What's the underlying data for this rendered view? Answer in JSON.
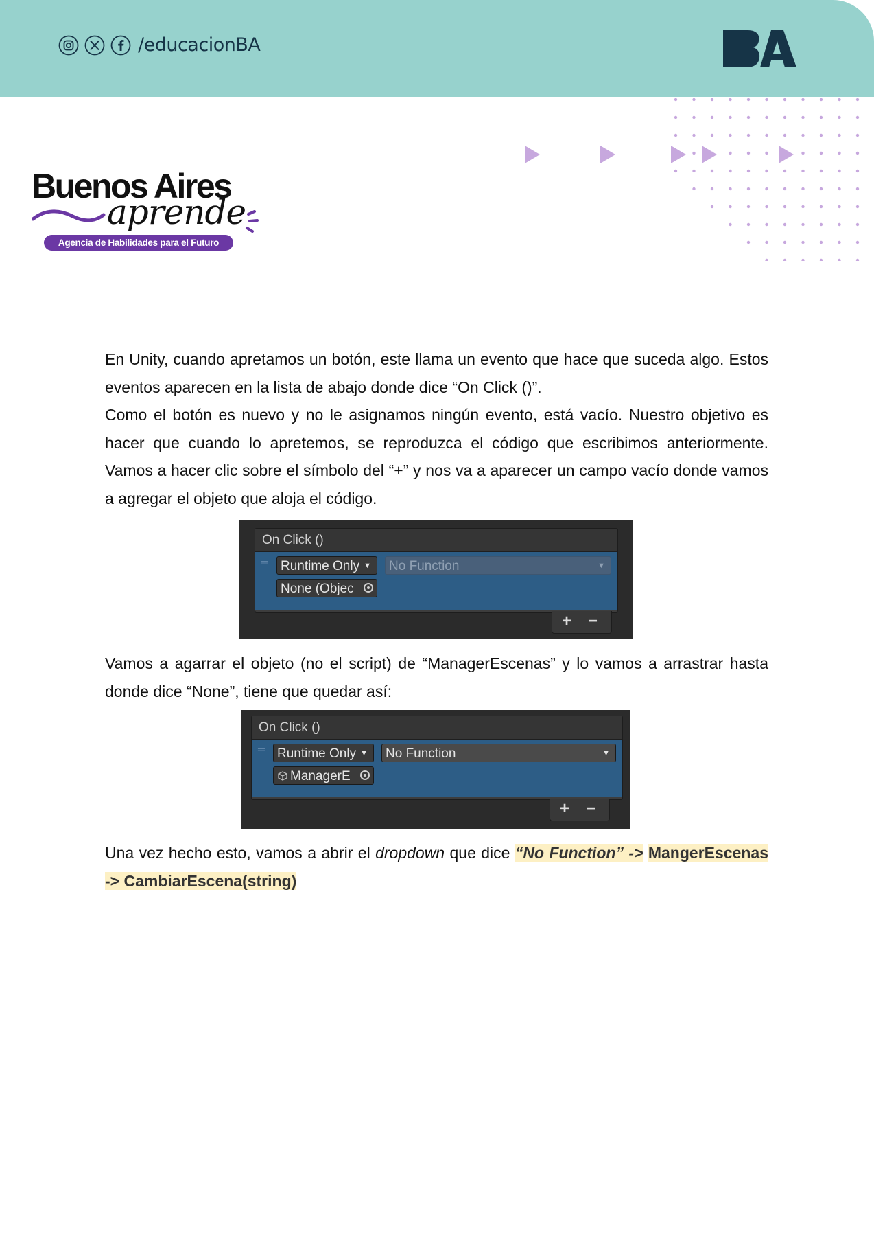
{
  "header": {
    "social_handle": "/educacionBA",
    "social_icons": [
      "instagram-icon",
      "x-icon",
      "facebook-icon"
    ],
    "ba_logo_text": "BA",
    "colors": {
      "band": "#97d2cd",
      "logo": "#163447",
      "accent": "#b98ed3"
    }
  },
  "brand": {
    "title": "Buenos Aires",
    "script": "aprende",
    "tagline": "Agencia de Habilidades para el Futuro",
    "colors": {
      "pill": "#6b38a4"
    }
  },
  "content": {
    "para1": "En Unity, cuando apretamos un botón, este llama un evento que hace que suceda algo. Estos eventos aparecen en la lista de abajo donde dice “On Click ()”.",
    "para2": "Como el botón es nuevo y no le asignamos ningún evento, está vacío. Nuestro objetivo es hacer que cuando lo apretemos, se reproduzca el código que escribimos anteriormente. Vamos a hacer clic sobre el símbolo del “+” y nos va a aparecer un campo vacío donde vamos a agregar el objeto que aloja el código.",
    "para3": "Vamos a agarrar el objeto (no el script) de “ManagerEscenas” y lo vamos a arrastrar hasta donde dice “None”, tiene que quedar así:",
    "para4_start": "Una vez hecho esto, vamos a abrir el ",
    "para4_italic": "dropdown",
    "para4_mid": " que dice ",
    "para4_highlight_italic": "“No Function” ->",
    "para4_highlight": "MangerEscenas -> CambiarEscena(string)"
  },
  "unity_panel_1": {
    "header": "On Click ()",
    "runtime": "Runtime Only",
    "function": "No Function",
    "object": "None (Objec",
    "plus": "+",
    "minus": "−"
  },
  "unity_panel_2": {
    "header": "On Click ()",
    "runtime": "Runtime Only",
    "function": "No Function",
    "object": "ManagerE",
    "plus": "+",
    "minus": "−"
  }
}
